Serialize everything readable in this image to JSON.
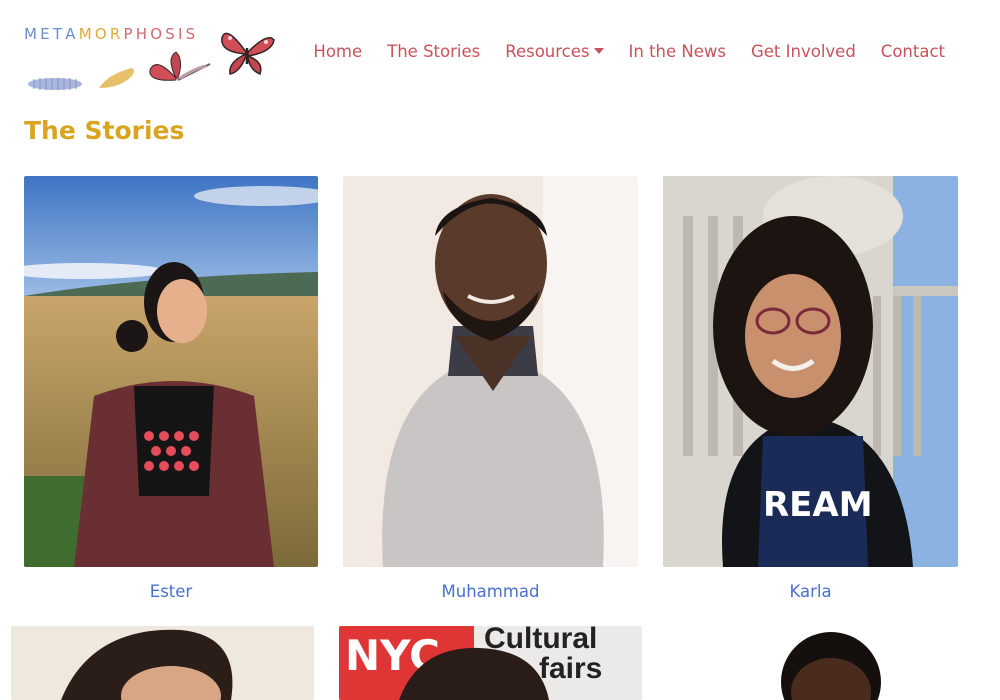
{
  "logo": {
    "letters": [
      {
        "ch": "M",
        "color": "#6a8fd1"
      },
      {
        "ch": "E",
        "color": "#6a8fd1"
      },
      {
        "ch": "T",
        "color": "#6a8fd1"
      },
      {
        "ch": "A",
        "color": "#6a8fd1"
      },
      {
        "ch": "M",
        "color": "#e0a93a"
      },
      {
        "ch": "O",
        "color": "#e0a93a"
      },
      {
        "ch": "R",
        "color": "#e0a93a"
      },
      {
        "ch": "P",
        "color": "#d4686f"
      },
      {
        "ch": "H",
        "color": "#d4686f"
      },
      {
        "ch": "O",
        "color": "#d4686f"
      },
      {
        "ch": "S",
        "color": "#d4686f"
      },
      {
        "ch": "I",
        "color": "#d4686f"
      },
      {
        "ch": "S",
        "color": "#d4686f"
      }
    ]
  },
  "nav": {
    "home": "Home",
    "stories": "The Stories",
    "resources": "Resources",
    "news": "In the News",
    "involved": "Get Involved",
    "contact": "Contact"
  },
  "page": {
    "title": "The Stories"
  },
  "stories": [
    {
      "name": "Ester"
    },
    {
      "name": "Muhammad"
    },
    {
      "name": "Karla"
    }
  ],
  "partial": {
    "sign_text_1": "Cultural",
    "sign_text_2": "fairs"
  },
  "colors": {
    "nav": "#c9535a",
    "title": "#d9a521",
    "name": "#4a6fd0"
  }
}
